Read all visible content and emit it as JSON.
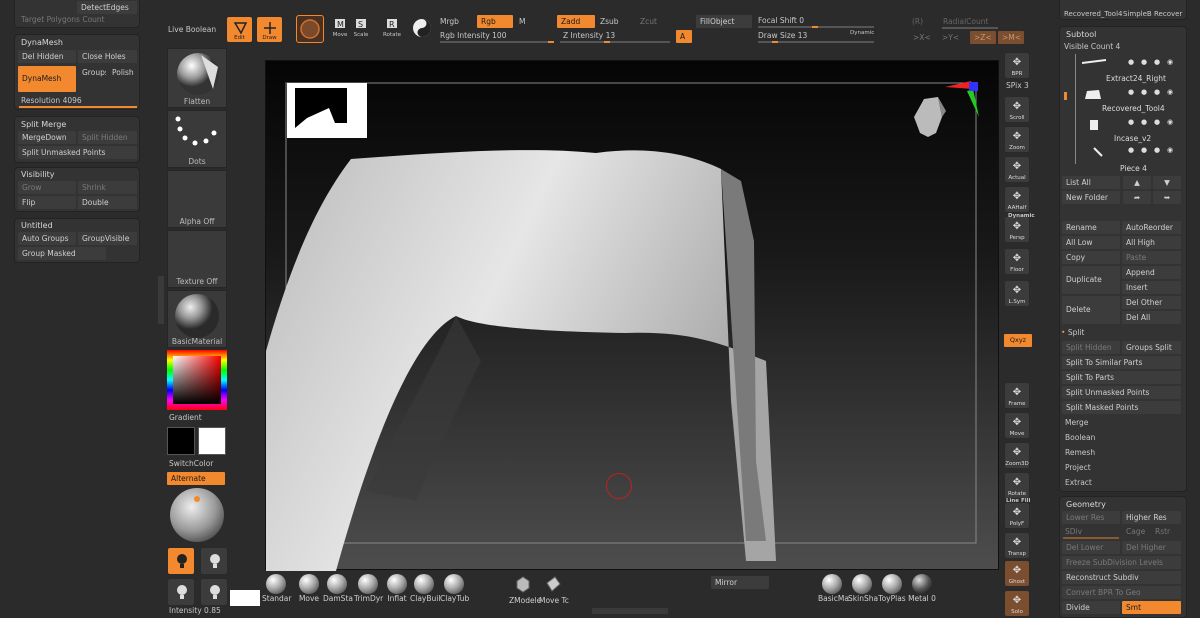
{
  "colors": {
    "accent": "#f2892f",
    "bg": "#2b2b2b",
    "panel": "#333333",
    "button": "#3c3c3c"
  },
  "top_left": {
    "detect_edges": "DetectEdges",
    "target_polygons": "Target Polygons Count"
  },
  "dynamesh": {
    "title": "DynaMesh",
    "del_hidden": "Del Hidden",
    "close_holes": "Close Holes",
    "dynamesh": "DynaMesh",
    "groups": "Groups",
    "polish": "Polish",
    "resolution_label": "Resolution",
    "resolution_value": "4096"
  },
  "split_merge": {
    "title": "Split Merge",
    "merge_down": "MergeDown",
    "split_hidden": "Split Hidden",
    "split_unmasked": "Split Unmasked Points"
  },
  "visibility": {
    "title": "Visibility",
    "grow": "Grow",
    "shrink": "Shrink",
    "flip": "Flip",
    "double": "Double"
  },
  "untitled": {
    "title": "Untitled",
    "auto_groups": "Auto Groups",
    "group_visible": "GroupVisible",
    "group_masked": "Group Masked"
  },
  "top_bar": {
    "live_boolean": "Live Boolean",
    "edit": "Edit",
    "draw": "Draw",
    "move": "Move",
    "scale": "Scale",
    "rotate": "Rotate",
    "mrgb": "Mrgb",
    "rgb": "Rgb",
    "m": "M",
    "rgb_intensity_label": "Rgb Intensity",
    "rgb_intensity_value": "100",
    "zadd": "Zadd",
    "zsub": "Zsub",
    "zcut": "Zcut",
    "z_intensity_label": "Z Intensity",
    "z_intensity_value": "13",
    "a": "A",
    "fill_object": "FillObject",
    "focal_shift_label": "Focal Shift",
    "focal_shift_value": "0",
    "draw_size_label": "Draw Size",
    "draw_size_value": "13",
    "dynamic": "Dynamic",
    "r": "(R)",
    "radial_count": "RadialCount",
    "x_sym": ">X<",
    "y_sym": ">Y<",
    "z_sym": ">Z<",
    "m_sym": ">M<"
  },
  "left_tools": {
    "flatten": "Flatten",
    "dots": "Dots",
    "alpha_off": "Alpha Off",
    "texture_off": "Texture Off",
    "basic_material": "BasicMaterial",
    "gradient": "Gradient",
    "switch_color": "SwitchColor",
    "alternate": "Alternate",
    "intensity_label": "Intensity",
    "intensity_value": "0.85"
  },
  "right_shelf": [
    "BPR",
    "Scroll",
    "Zoom",
    "Actual",
    "AAHalf",
    "Persp",
    "Floor",
    "L.Sym",
    "",
    "Frame",
    "Move",
    "Zoom3D",
    "Rotate",
    "PolyF",
    "Transp",
    "Ghost",
    "Solo"
  ],
  "right_shelf_extra": {
    "spix_label": "SPix",
    "spix_value": "3",
    "dynamic": "Dynamic",
    "line_fill": "Line Fill",
    "xyz": "Qxyz"
  },
  "subtool": {
    "top_tools": [
      "Recovered_Tool4",
      "SimpleB",
      "Recover"
    ],
    "title": "Subtool",
    "visible_count": "Visible Count 4",
    "items": [
      "Extract24_Right",
      "Recovered_Tool4",
      "Incase_v2",
      "Piece 4"
    ],
    "list_all": "List All",
    "new_folder": "New Folder",
    "rename": "Rename",
    "auto_reorder": "AutoReorder",
    "all_low": "All Low",
    "all_high": "All High",
    "copy": "Copy",
    "paste": "Paste",
    "duplicate": "Duplicate",
    "append": "Append",
    "insert": "Insert",
    "delete": "Delete",
    "del_other": "Del Other",
    "del_all": "Del All",
    "split": "Split",
    "split_hidden": "Split Hidden",
    "groups_split": "Groups Split",
    "split_similar": "Split To Similar Parts",
    "split_parts": "Split To Parts",
    "split_unmasked": "Split Unmasked Points",
    "split_masked": "Split Masked Points",
    "merge": "Merge",
    "boolean": "Boolean",
    "remesh": "Remesh",
    "project": "Project",
    "extract": "Extract"
  },
  "geometry": {
    "title": "Geometry",
    "lower_res": "Lower Res",
    "higher_res": "Higher Res",
    "sdiv": "SDiv",
    "cage": "Cage",
    "rstr": "Rstr",
    "del_lower": "Del Lower",
    "del_higher": "Del Higher",
    "freeze": "Freeze SubDivision Levels",
    "reconstruct": "Reconstruct Subdiv",
    "convert_bpr": "Convert BPR To Geo",
    "divide": "Divide",
    "smt": "Smt"
  },
  "bottom_shelf": {
    "brushes": [
      "Standar",
      "Move",
      "DamSta",
      "TrimDyr",
      "Inflat",
      "ClayBuil",
      "ClayTub"
    ],
    "zmodeler": "ZModele",
    "move_tool": "Move Tc",
    "mirror": "Mirror",
    "materials": [
      "BasicMa",
      "SkinSha",
      "ToyPlas",
      "Metal 0"
    ]
  }
}
